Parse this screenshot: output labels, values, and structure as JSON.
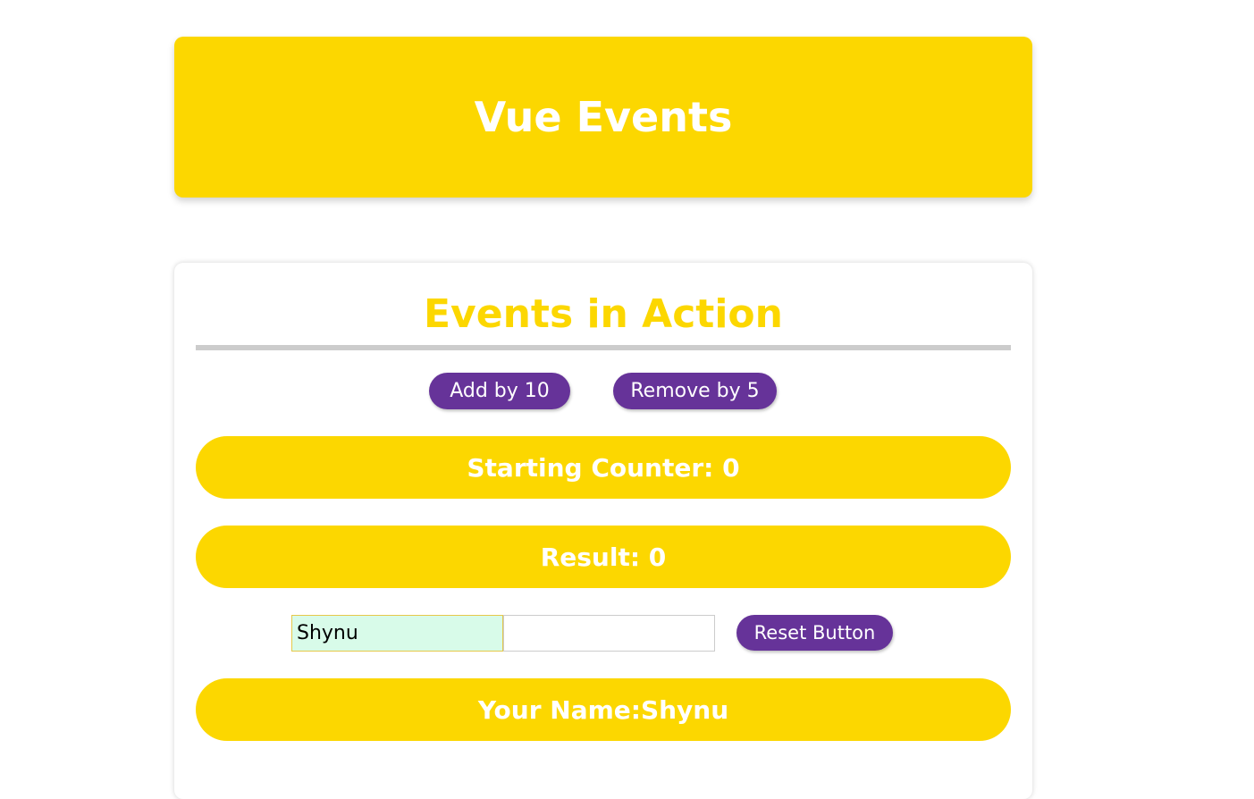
{
  "header": {
    "title": "Vue Events"
  },
  "card": {
    "title": "Events in Action",
    "add_button": "Add by 10",
    "remove_button": "Remove by 5",
    "starting_counter": "Starting Counter: 0",
    "result": "Result: 0",
    "name_input_value": "Shynu",
    "second_input_value": "",
    "reset_button": "Reset Button",
    "your_name": "Your Name:Shynu"
  },
  "colors": {
    "accent_yellow": "#fcd700",
    "button_purple": "#663399",
    "divider_gray": "#cccccc",
    "input_focus_bg": "#d8fbe9"
  }
}
